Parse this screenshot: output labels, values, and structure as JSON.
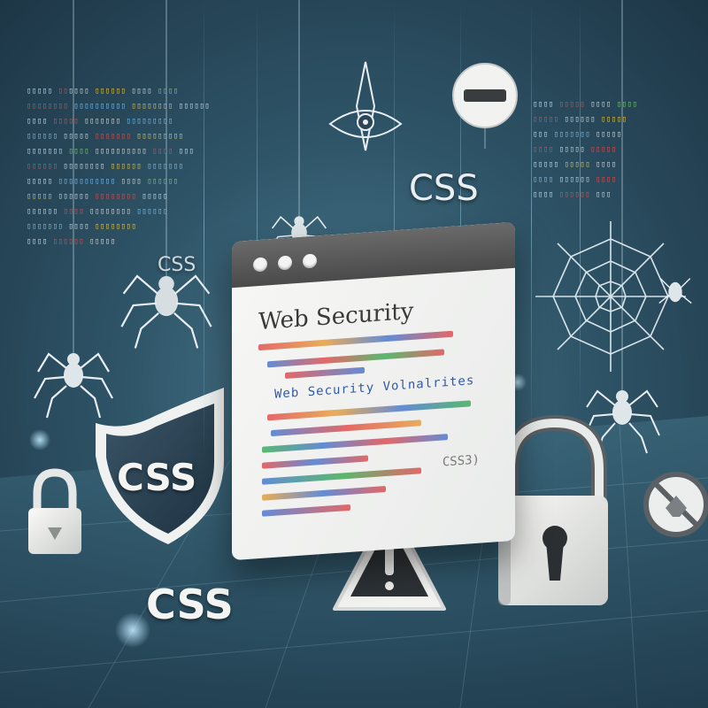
{
  "labels": {
    "css_top": "CSS",
    "css_left": "CSS",
    "css_shield": "CSS",
    "css_bottom": "CSS"
  },
  "window": {
    "title": "Web Security",
    "subtitle": "Web Security Volnalrites",
    "tag": "CSS3)"
  },
  "colors": {
    "background": "#2f5568",
    "window": "#f2f3f2",
    "titlebar": "#555555",
    "shield_dark": "#2e4454",
    "lock": "#f0f0ee",
    "accent": "#7fc8ff"
  },
  "icons": [
    "shield-icon",
    "padlock-icon",
    "warning-icon",
    "spider-icon",
    "spider-web-icon",
    "blocked-icon",
    "minus-icon",
    "eye-icon"
  ]
}
